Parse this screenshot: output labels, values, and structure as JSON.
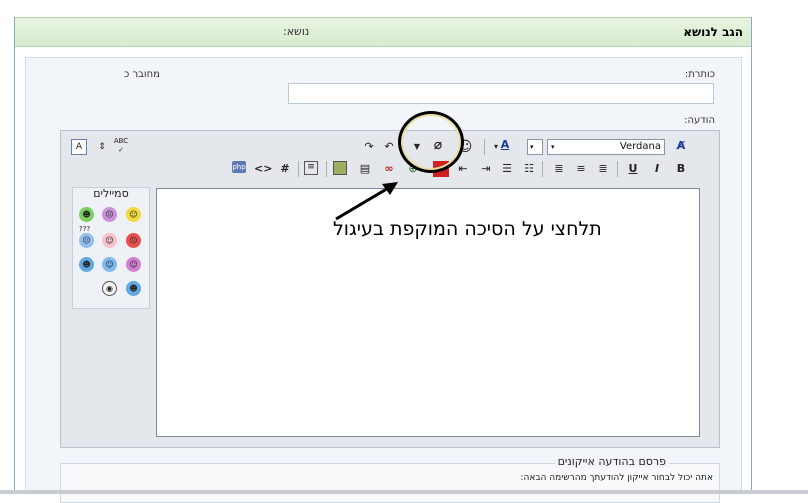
{
  "header": {
    "title": "הגב לנושא",
    "subject_label": "נושא:"
  },
  "form": {
    "title_label": "כותרת:",
    "author_label": "מחובר כ",
    "message_label": "הודעה:",
    "title_value": ""
  },
  "toolbar": {
    "font_name": "Verdana",
    "spell_label": "ABC",
    "bold": "B",
    "italic": "I",
    "underline": "U",
    "hash": "#",
    "code": "<>",
    "php": "php"
  },
  "smilies": {
    "title": "סמיילים",
    "mystery": "???"
  },
  "icons": {
    "legend": "פרסם בהודעה אייקונים",
    "description": "אתה יכול לבחור אייקון להודעתך מהרשימה הבאה:"
  },
  "annotation": {
    "text": "תלחצי על הסיכה המוקפת בעיגול"
  },
  "colors": {
    "accent_red": "#d02020",
    "header_bg": "#e0f0d8"
  }
}
